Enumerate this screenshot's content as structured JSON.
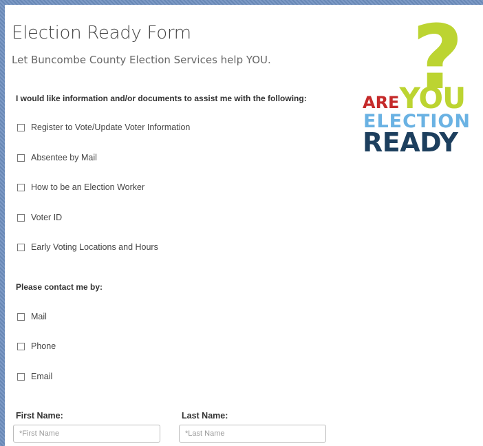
{
  "form": {
    "title": "Election Ready Form",
    "subtitle": "Let Buncombe County Election Services help YOU."
  },
  "info_section": {
    "heading": "I would like information and/or documents to assist me with the following:",
    "options": [
      {
        "label": "Register to Vote/Update Voter Information",
        "checked": false
      },
      {
        "label": "Absentee by Mail",
        "checked": false
      },
      {
        "label": "How to be an Election Worker",
        "checked": false
      },
      {
        "label": "Voter ID",
        "checked": false
      },
      {
        "label": "Early Voting Locations and Hours",
        "checked": false
      }
    ]
  },
  "contact_section": {
    "heading": "Please contact me by:",
    "options": [
      {
        "label": "Mail",
        "checked": false
      },
      {
        "label": "Phone",
        "checked": false
      },
      {
        "label": "Email",
        "checked": false
      }
    ]
  },
  "name_fields": {
    "first_label": "First Name:",
    "first_placeholder": "*First Name",
    "first_value": "",
    "last_label": "Last Name:",
    "last_placeholder": "*Last Name",
    "last_value": ""
  },
  "logo": {
    "question_mark": "?",
    "are": "ARE",
    "you": "YOU",
    "election": "ELECTION",
    "ready": "READY"
  },
  "colors": {
    "logo_green": "#bcd431",
    "logo_red": "#c52a2a",
    "logo_light_blue": "#6ab2e3",
    "logo_navy": "#1d3f5e",
    "page_border_blue": "#6e8fbf"
  }
}
